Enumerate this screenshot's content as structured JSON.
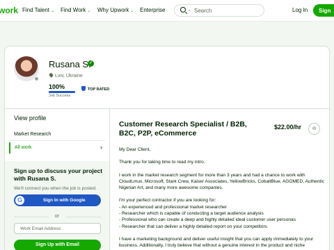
{
  "nav": {
    "logo": "work",
    "find_talent": "Find Talent",
    "find_work": "Find Work",
    "why_upwork": "Why Upwork",
    "enterprise": "Enterprise",
    "search_placeholder": "Search",
    "login": "Log In",
    "signup": "Sign"
  },
  "profile": {
    "name": "Rusana S.",
    "location": "Lviv, Ukraine",
    "job_success_pct": "100%",
    "job_success_fraction": 1.0,
    "job_success_label": "Job Success",
    "badge": "TOP RATED",
    "accent_color": "#14a800",
    "badge_color": "#1f57c3"
  },
  "left": {
    "view_profile": "View profile",
    "items": [
      {
        "label": "Market Research"
      },
      {
        "label": "All work",
        "active": true
      }
    ],
    "signup_title": "Sign up to discuss your project with Rusana S.",
    "signup_sub": "We'll connect you when the job is posted.",
    "google_btn": "Sign In with Google",
    "google_icon": "G",
    "or": "or",
    "email_placeholder": "Work Email Address",
    "email_btn": "Sign Up with Email"
  },
  "main": {
    "headline": "Customer Research Specialist / B2B, B2C, P2P, eCommerce",
    "rate": "$22.00/hr",
    "paragraphs": [
      "My Dear Client,",
      "Thank you for taking time to read my intro.",
      "I work in the market research segment for more than 3 years and had a chance to work with CloudLmux, Microsoft, Stark Crew, Kaiser Associates, YellowBricks, CobaltBlue, AGOMED, Authentic Nigerian Art, and many more awesome companies.",
      "I'm your perfect contractor if you are looking for:\n- An experienced and professional market researcher\n- Researcher which is capable of conducting a target audience analysis\n- Professional who can create a deep and highly detailed ideal customer user personas\n- Researcher that can deliver a highly detailed report on your competitors",
      "I have a marketing background and deliver useful insight that you can apply immediately to your business. Additionally, I truly believe that without a genuine interest in the product and niche"
    ]
  }
}
